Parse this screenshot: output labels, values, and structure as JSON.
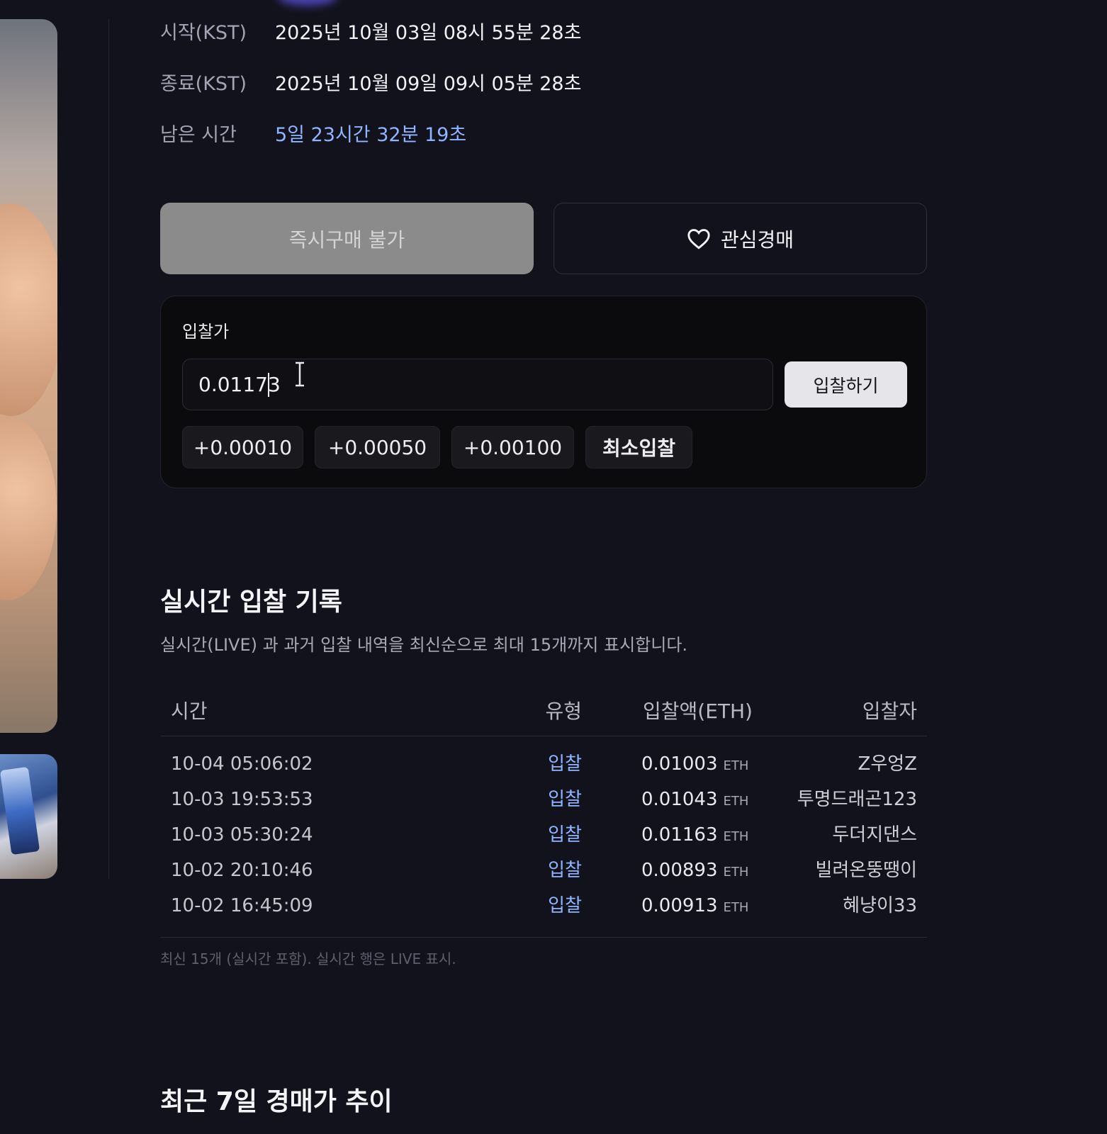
{
  "schedule": {
    "start_label": "시작(KST)",
    "start_value": "2025년 10월 03일 08시 55분 28초",
    "end_label": "종료(KST)",
    "end_value": "2025년 10월 09일 09시 05분 28초",
    "remaining_label": "남은 시간",
    "remaining_value": "5일 23시간 32분 19초"
  },
  "actions": {
    "buy_now_label": "즉시구매 불가",
    "watch_label": "관심경매",
    "watch_icon": "heart-icon"
  },
  "bid": {
    "label": "입찰가",
    "input_value": "0.01173",
    "submit_label": "입찰하기",
    "increments": [
      "+0.00010",
      "+0.00050",
      "+0.00100"
    ],
    "min_bid_label": "최소입찰"
  },
  "history": {
    "title": "실시간 입찰 기록",
    "description": "실시간(LIVE) 과 과거 입찰 내역을 최신순으로 최대 15개까지 표시합니다.",
    "columns": [
      "시간",
      "유형",
      "입찰액(ETH)",
      "입찰자"
    ],
    "rows": [
      {
        "time": "10-04 05:06:02",
        "type": "입찰",
        "amount": "0.01003",
        "unit": "ETH",
        "bidder": "Z우엉Z"
      },
      {
        "time": "10-03 19:53:53",
        "type": "입찰",
        "amount": "0.01043",
        "unit": "ETH",
        "bidder": "투명드래곤123"
      },
      {
        "time": "10-03 05:30:24",
        "type": "입찰",
        "amount": "0.01163",
        "unit": "ETH",
        "bidder": "두더지댄스"
      },
      {
        "time": "10-02 20:10:46",
        "type": "입찰",
        "amount": "0.00893",
        "unit": "ETH",
        "bidder": "빌려온뚱땡이"
      },
      {
        "time": "10-02 16:45:09",
        "type": "입찰",
        "amount": "0.00913",
        "unit": "ETH",
        "bidder": "혜냥이33"
      }
    ],
    "footnote": "최신 15개 (실시간 포함). 실시간 행은 LIVE 표시."
  },
  "trend": {
    "title": "최근 7일 경매가 추이"
  }
}
